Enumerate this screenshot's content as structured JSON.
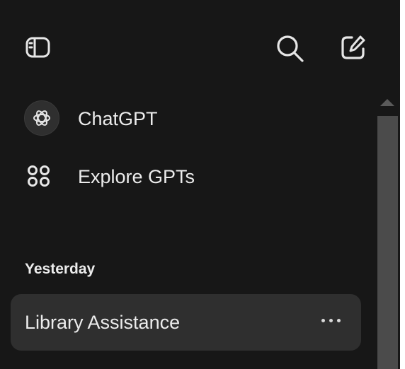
{
  "header": {
    "toggle_sidebar_icon": "sidebar-toggle-icon",
    "search_icon": "search-icon",
    "new_chat_icon": "new-chat-icon"
  },
  "nav": {
    "items": [
      {
        "label": "ChatGPT",
        "icon": "openai-logo-icon"
      },
      {
        "label": "Explore GPTs",
        "icon": "grid-icon"
      }
    ]
  },
  "history": {
    "section_label": "Yesterday",
    "chats": [
      {
        "title": "Library Assistance",
        "more_icon": "more-options-icon"
      }
    ]
  },
  "colors": {
    "sidebar_bg": "#171717",
    "active_chat_bg": "#2f2f2f",
    "text": "#ececec",
    "scroll_thumb": "#4b4b4b"
  }
}
